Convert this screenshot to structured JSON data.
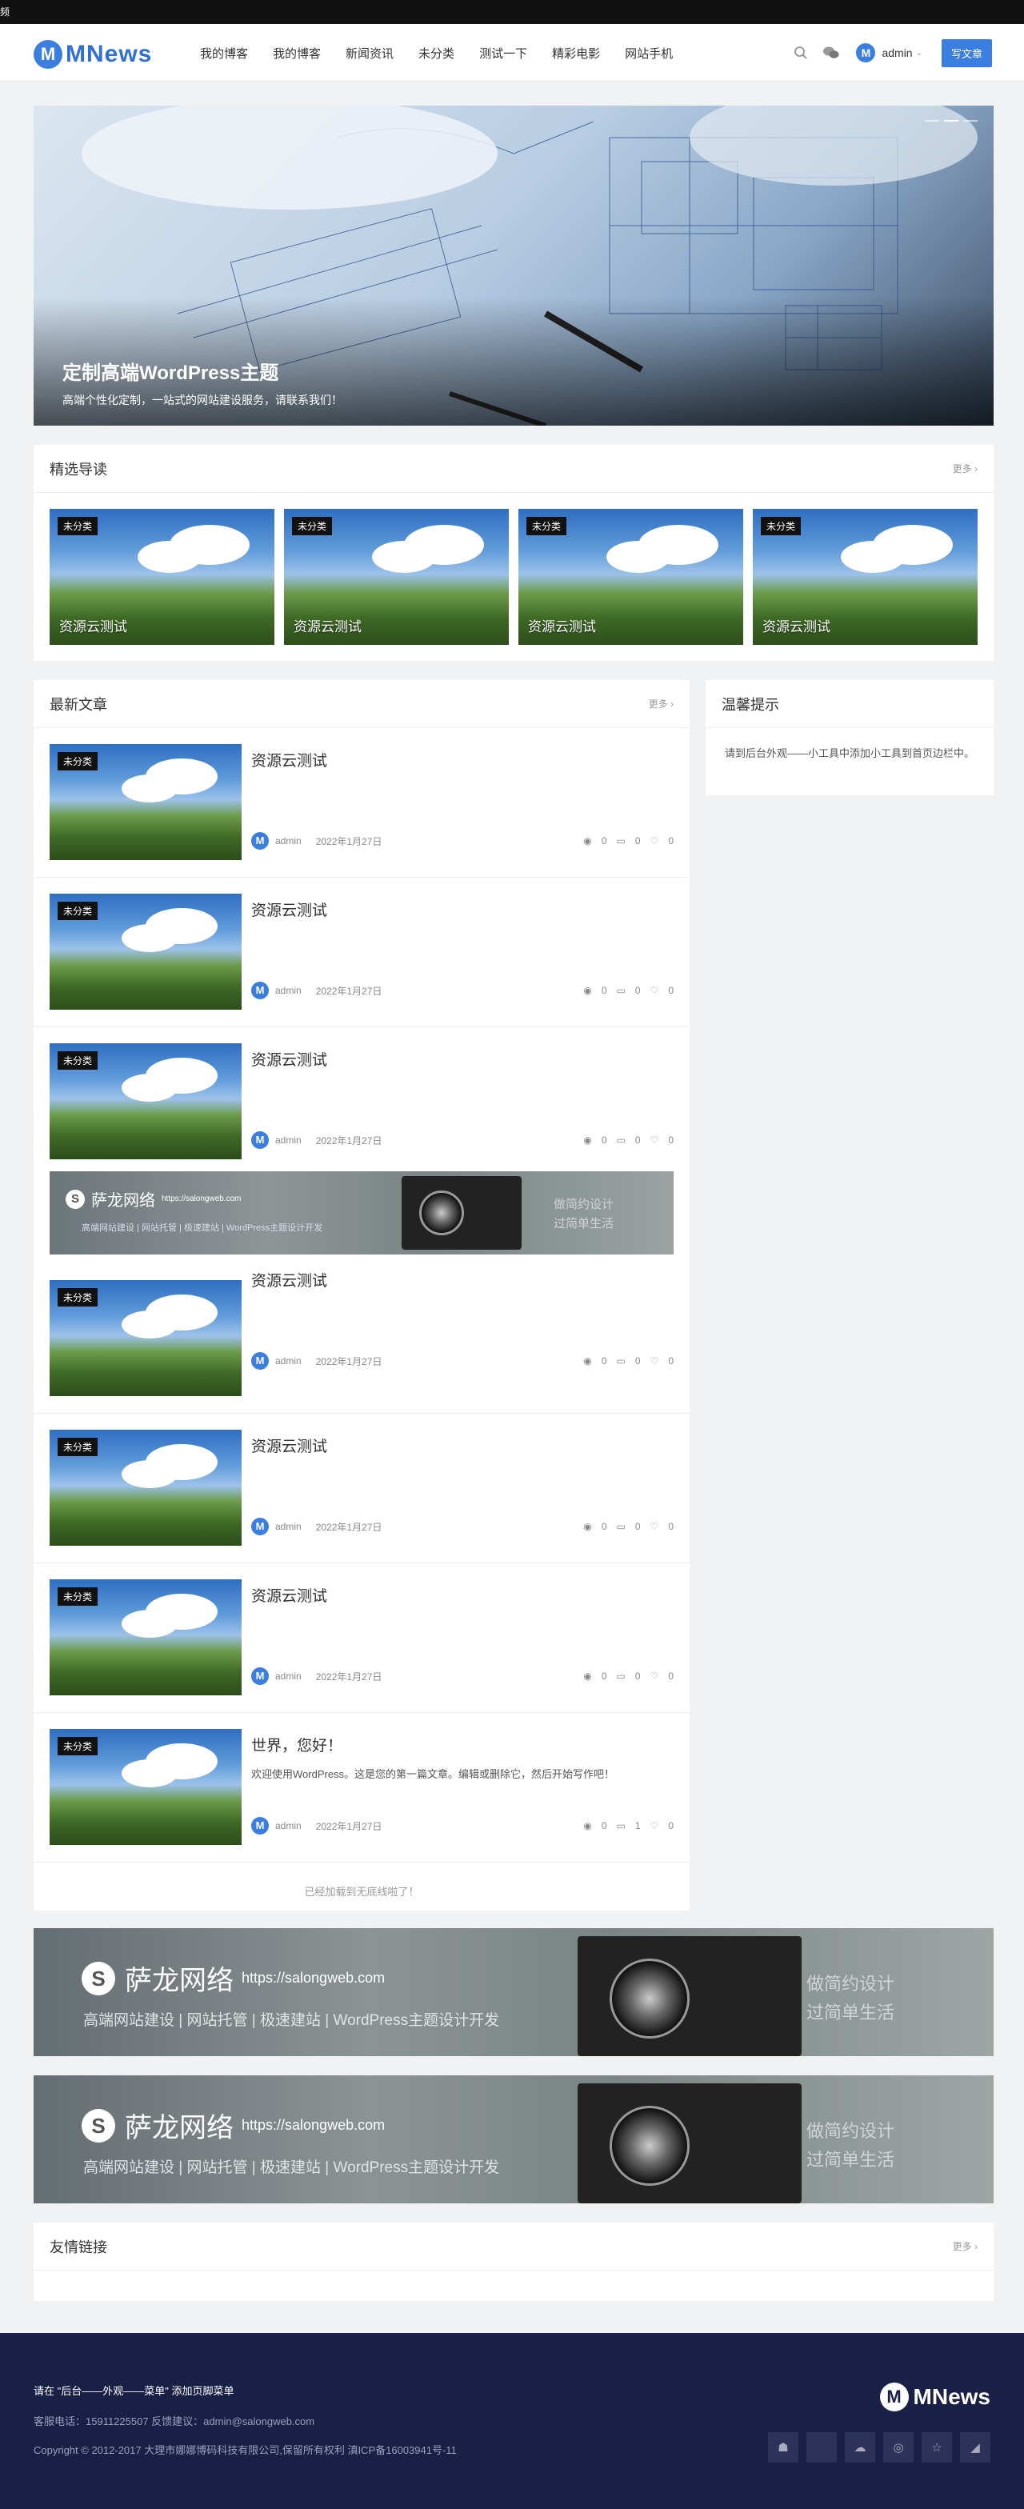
{
  "topbar": {
    "text": "频"
  },
  "header": {
    "logo_letter": "M",
    "logo_text": "MNews",
    "nav": [
      "我的博客",
      "我的博客",
      "新闻资讯",
      "未分类",
      "测试一下",
      "精彩电影",
      "网站手机"
    ],
    "user_initial": "M",
    "username": "admin",
    "write_label": "写文章",
    "icons": [
      "search-icon",
      "wechat-icon",
      "chevron-down-icon"
    ]
  },
  "hero": {
    "title": "定制高端WordPress主题",
    "subtitle": "高端个性化定制，一站式的网站建设服务，请联系我们！"
  },
  "featured": {
    "title": "精选导读",
    "more": "更多 ›",
    "items": [
      {
        "tag": "未分类",
        "title": "资源云测试"
      },
      {
        "tag": "未分类",
        "title": "资源云测试"
      },
      {
        "tag": "未分类",
        "title": "资源云测试"
      },
      {
        "tag": "未分类",
        "title": "资源云测试"
      }
    ]
  },
  "latest": {
    "title": "最新文章",
    "more": "更多 ›",
    "posts": [
      {
        "tag": "未分类",
        "title": "资源云测试",
        "excerpt": "",
        "author": "admin",
        "date": "2022年1月27日",
        "views": "0",
        "comments": "0",
        "likes": "0"
      },
      {
        "tag": "未分类",
        "title": "资源云测试",
        "excerpt": "",
        "author": "admin",
        "date": "2022年1月27日",
        "views": "0",
        "comments": "0",
        "likes": "0"
      },
      {
        "tag": "未分类",
        "title": "资源云测试",
        "excerpt": "",
        "author": "admin",
        "date": "2022年1月27日",
        "views": "0",
        "comments": "0",
        "likes": "0"
      },
      {
        "tag": "未分类",
        "title": "资源云测试",
        "excerpt": "",
        "author": "admin",
        "date": "2022年1月27日",
        "views": "0",
        "comments": "0",
        "likes": "0"
      },
      {
        "tag": "未分类",
        "title": "资源云测试",
        "excerpt": "",
        "author": "admin",
        "date": "2022年1月27日",
        "views": "0",
        "comments": "0",
        "likes": "0"
      },
      {
        "tag": "未分类",
        "title": "资源云测试",
        "excerpt": "",
        "author": "admin",
        "date": "2022年1月27日",
        "views": "0",
        "comments": "0",
        "likes": "0"
      },
      {
        "tag": "未分类",
        "title": "世界，您好！",
        "excerpt": "欢迎使用WordPress。这是您的第一篇文章。编辑或删除它，然后开始写作吧！",
        "author": "admin",
        "date": "2022年1月27日",
        "views": "0",
        "comments": "1",
        "likes": "0"
      }
    ],
    "loaded_text": "已经加载到无底线啦了！"
  },
  "ad": {
    "brand": "萨龙网络",
    "url": "https://salongweb.com",
    "services": "高端网站建设 | 网站托管 | 极速建站 | WordPress主题设计开发",
    "slogan1": "做简约设计",
    "slogan2": "过简单生活"
  },
  "sidebar": {
    "title": "温馨提示",
    "body": "请到后台外观——小工具中添加小工具到首页边栏中。"
  },
  "links": {
    "title": "友情链接",
    "more": "更多 ›"
  },
  "footer": {
    "menu_hint": "请在 \"后台——外观——菜单\" 添加页脚菜单",
    "contact": "客服电话：15911225507 反馈建议：admin@salongweb.com",
    "copyright": "Copyright © 2012-2017 大理市娜娜博码科技有限公司,保留所有权利 滇ICP备16003941号-11",
    "logo_letter": "M",
    "logo_text": "MNews",
    "icons": [
      "android-icon",
      "apple-icon",
      "wechat-icon",
      "weibo-icon",
      "star-icon",
      "rss-icon"
    ]
  },
  "colors": {
    "accent": "#3a7fe0",
    "footer_bg": "#1a1f45"
  }
}
